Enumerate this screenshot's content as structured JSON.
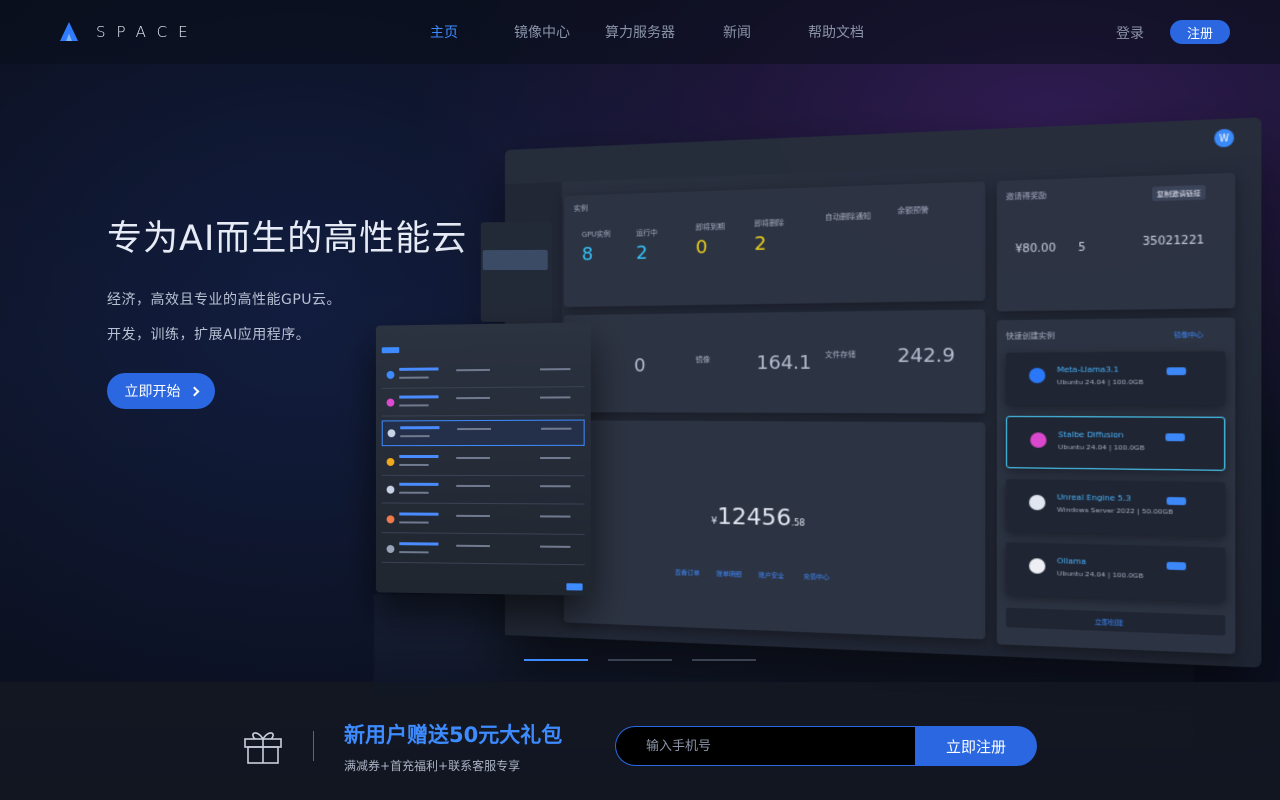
{
  "header": {
    "logo_text": "SPACE",
    "nav": [
      "主页",
      "镜像中心",
      "算力服务器",
      "新闻",
      "帮助文档"
    ],
    "active_nav": "主页",
    "login": "登录",
    "register": "注册"
  },
  "hero": {
    "title": "专为AI而生的高性能云",
    "subtitle1": "经济，高效且专业的高性能GPU云。",
    "subtitle2": "开发，训练，扩展AI应用程序。",
    "cta": "立即开始"
  },
  "dashboard": {
    "instance_title": "实例",
    "gpu_label": "GPU实例",
    "gpu_value": "8",
    "running_label": "运行中",
    "running_value": "2",
    "expiring_label": "即将到期",
    "expiring_value": "0",
    "to_delete_label": "即将删除",
    "to_delete_value": "2",
    "auto_renew_label": "自动删除通知",
    "balance_warn_label": "余额预警",
    "mirror_label": "镜像",
    "mirror_value": "164.1",
    "storage_label": "文件存储",
    "storage_value": "242.9",
    "zero_value": "0",
    "balance_value": "12456",
    "balance_cents": ".58",
    "currency": "¥",
    "invite_title": "邀请得奖励",
    "invite_copy": "复制邀请链接",
    "invite_amount": "¥80.00",
    "invite_count": "5",
    "invite_code": "35021221",
    "quick_title": "快速创建实例",
    "quick_link": "镜像中心",
    "quick_items": [
      {
        "name": "Meta-Llama3.1",
        "sub": "Ubuntu 24.04 | 100.0GB"
      },
      {
        "name": "Stalbe Diffusion",
        "sub": "Ubuntu 24.04 | 100.0GB"
      },
      {
        "name": "Unreal Engine 5.3",
        "sub": "Windows Server 2022 | 50.00GB"
      },
      {
        "name": "Ollama",
        "sub": "Ubuntu 24.04 | 100.0GB"
      }
    ],
    "create_now": "立即创建",
    "avatar": "W",
    "links": [
      "查看订单",
      "账单明细",
      "账户安全",
      "充值中心"
    ]
  },
  "promo": {
    "title": "新用户赠送50元大礼包",
    "subtitle": "满减券+首充福利+联系客服专享",
    "phone_placeholder": "输入手机号",
    "register_now": "立即注册"
  },
  "colors": {
    "accent": "#2a67e0",
    "active_nav": "#3d8bff",
    "background": "#0e1426"
  }
}
